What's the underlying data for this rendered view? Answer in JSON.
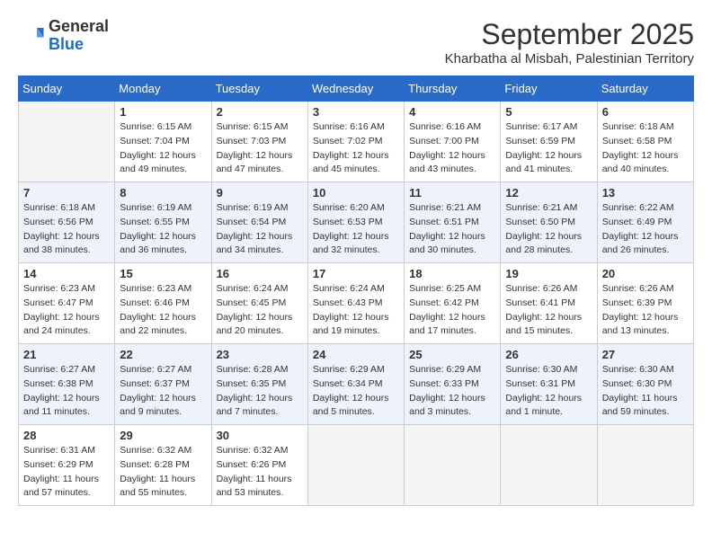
{
  "logo": {
    "general": "General",
    "blue": "Blue"
  },
  "title": "September 2025",
  "location": "Kharbatha al Misbah, Palestinian Territory",
  "headers": [
    "Sunday",
    "Monday",
    "Tuesday",
    "Wednesday",
    "Thursday",
    "Friday",
    "Saturday"
  ],
  "weeks": [
    [
      {
        "day": "",
        "lines": []
      },
      {
        "day": "1",
        "lines": [
          "Sunrise: 6:15 AM",
          "Sunset: 7:04 PM",
          "Daylight: 12 hours",
          "and 49 minutes."
        ]
      },
      {
        "day": "2",
        "lines": [
          "Sunrise: 6:15 AM",
          "Sunset: 7:03 PM",
          "Daylight: 12 hours",
          "and 47 minutes."
        ]
      },
      {
        "day": "3",
        "lines": [
          "Sunrise: 6:16 AM",
          "Sunset: 7:02 PM",
          "Daylight: 12 hours",
          "and 45 minutes."
        ]
      },
      {
        "day": "4",
        "lines": [
          "Sunrise: 6:16 AM",
          "Sunset: 7:00 PM",
          "Daylight: 12 hours",
          "and 43 minutes."
        ]
      },
      {
        "day": "5",
        "lines": [
          "Sunrise: 6:17 AM",
          "Sunset: 6:59 PM",
          "Daylight: 12 hours",
          "and 41 minutes."
        ]
      },
      {
        "day": "6",
        "lines": [
          "Sunrise: 6:18 AM",
          "Sunset: 6:58 PM",
          "Daylight: 12 hours",
          "and 40 minutes."
        ]
      }
    ],
    [
      {
        "day": "7",
        "lines": [
          "Sunrise: 6:18 AM",
          "Sunset: 6:56 PM",
          "Daylight: 12 hours",
          "and 38 minutes."
        ]
      },
      {
        "day": "8",
        "lines": [
          "Sunrise: 6:19 AM",
          "Sunset: 6:55 PM",
          "Daylight: 12 hours",
          "and 36 minutes."
        ]
      },
      {
        "day": "9",
        "lines": [
          "Sunrise: 6:19 AM",
          "Sunset: 6:54 PM",
          "Daylight: 12 hours",
          "and 34 minutes."
        ]
      },
      {
        "day": "10",
        "lines": [
          "Sunrise: 6:20 AM",
          "Sunset: 6:53 PM",
          "Daylight: 12 hours",
          "and 32 minutes."
        ]
      },
      {
        "day": "11",
        "lines": [
          "Sunrise: 6:21 AM",
          "Sunset: 6:51 PM",
          "Daylight: 12 hours",
          "and 30 minutes."
        ]
      },
      {
        "day": "12",
        "lines": [
          "Sunrise: 6:21 AM",
          "Sunset: 6:50 PM",
          "Daylight: 12 hours",
          "and 28 minutes."
        ]
      },
      {
        "day": "13",
        "lines": [
          "Sunrise: 6:22 AM",
          "Sunset: 6:49 PM",
          "Daylight: 12 hours",
          "and 26 minutes."
        ]
      }
    ],
    [
      {
        "day": "14",
        "lines": [
          "Sunrise: 6:23 AM",
          "Sunset: 6:47 PM",
          "Daylight: 12 hours",
          "and 24 minutes."
        ]
      },
      {
        "day": "15",
        "lines": [
          "Sunrise: 6:23 AM",
          "Sunset: 6:46 PM",
          "Daylight: 12 hours",
          "and 22 minutes."
        ]
      },
      {
        "day": "16",
        "lines": [
          "Sunrise: 6:24 AM",
          "Sunset: 6:45 PM",
          "Daylight: 12 hours",
          "and 20 minutes."
        ]
      },
      {
        "day": "17",
        "lines": [
          "Sunrise: 6:24 AM",
          "Sunset: 6:43 PM",
          "Daylight: 12 hours",
          "and 19 minutes."
        ]
      },
      {
        "day": "18",
        "lines": [
          "Sunrise: 6:25 AM",
          "Sunset: 6:42 PM",
          "Daylight: 12 hours",
          "and 17 minutes."
        ]
      },
      {
        "day": "19",
        "lines": [
          "Sunrise: 6:26 AM",
          "Sunset: 6:41 PM",
          "Daylight: 12 hours",
          "and 15 minutes."
        ]
      },
      {
        "day": "20",
        "lines": [
          "Sunrise: 6:26 AM",
          "Sunset: 6:39 PM",
          "Daylight: 12 hours",
          "and 13 minutes."
        ]
      }
    ],
    [
      {
        "day": "21",
        "lines": [
          "Sunrise: 6:27 AM",
          "Sunset: 6:38 PM",
          "Daylight: 12 hours",
          "and 11 minutes."
        ]
      },
      {
        "day": "22",
        "lines": [
          "Sunrise: 6:27 AM",
          "Sunset: 6:37 PM",
          "Daylight: 12 hours",
          "and 9 minutes."
        ]
      },
      {
        "day": "23",
        "lines": [
          "Sunrise: 6:28 AM",
          "Sunset: 6:35 PM",
          "Daylight: 12 hours",
          "and 7 minutes."
        ]
      },
      {
        "day": "24",
        "lines": [
          "Sunrise: 6:29 AM",
          "Sunset: 6:34 PM",
          "Daylight: 12 hours",
          "and 5 minutes."
        ]
      },
      {
        "day": "25",
        "lines": [
          "Sunrise: 6:29 AM",
          "Sunset: 6:33 PM",
          "Daylight: 12 hours",
          "and 3 minutes."
        ]
      },
      {
        "day": "26",
        "lines": [
          "Sunrise: 6:30 AM",
          "Sunset: 6:31 PM",
          "Daylight: 12 hours",
          "and 1 minute."
        ]
      },
      {
        "day": "27",
        "lines": [
          "Sunrise: 6:30 AM",
          "Sunset: 6:30 PM",
          "Daylight: 11 hours",
          "and 59 minutes."
        ]
      }
    ],
    [
      {
        "day": "28",
        "lines": [
          "Sunrise: 6:31 AM",
          "Sunset: 6:29 PM",
          "Daylight: 11 hours",
          "and 57 minutes."
        ]
      },
      {
        "day": "29",
        "lines": [
          "Sunrise: 6:32 AM",
          "Sunset: 6:28 PM",
          "Daylight: 11 hours",
          "and 55 minutes."
        ]
      },
      {
        "day": "30",
        "lines": [
          "Sunrise: 6:32 AM",
          "Sunset: 6:26 PM",
          "Daylight: 11 hours",
          "and 53 minutes."
        ]
      },
      {
        "day": "",
        "lines": []
      },
      {
        "day": "",
        "lines": []
      },
      {
        "day": "",
        "lines": []
      },
      {
        "day": "",
        "lines": []
      }
    ]
  ]
}
